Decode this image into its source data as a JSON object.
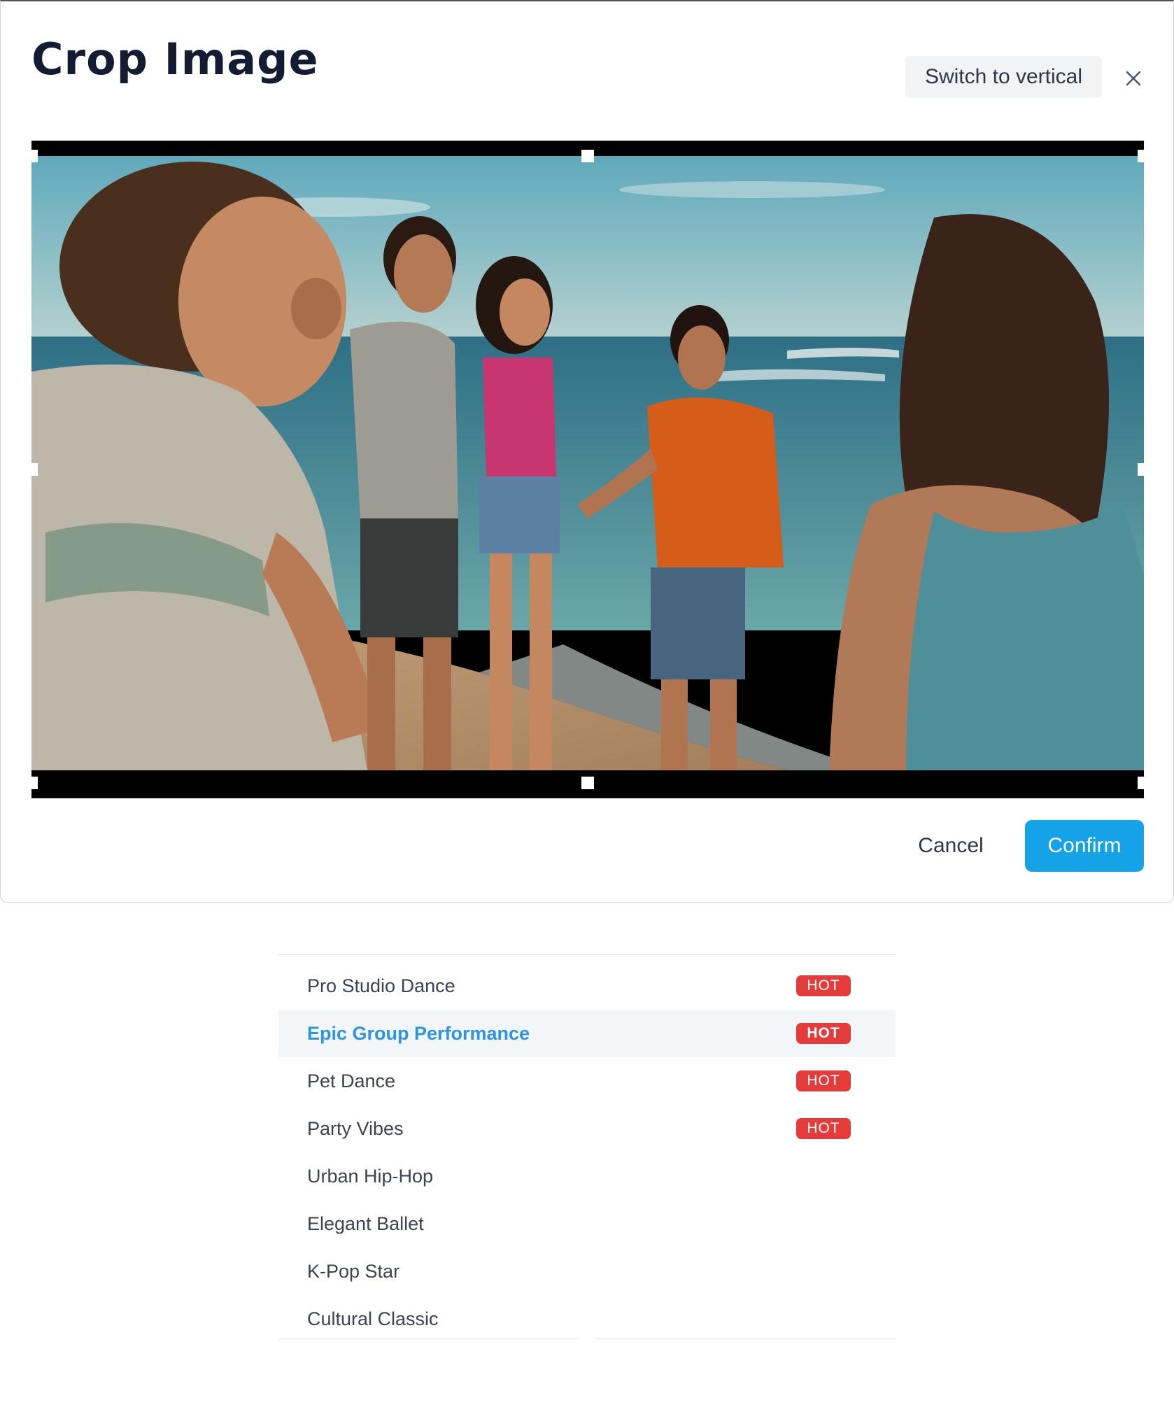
{
  "modal": {
    "title": "Crop Image",
    "switch_label": "Switch to vertical",
    "cancel_label": "Cancel",
    "confirm_label": "Confirm"
  },
  "colors": {
    "accent": "#15a3e7",
    "hot_badge": "#e43b3b",
    "active_item_text": "#2f95e0"
  },
  "icons": {
    "close": "close-icon"
  },
  "dropdown": {
    "badge_label": "HOT",
    "active_index": 1,
    "items": [
      {
        "label": "Pro Studio Dance",
        "hot": true
      },
      {
        "label": "Epic Group Performance",
        "hot": true
      },
      {
        "label": "Pet Dance",
        "hot": true
      },
      {
        "label": "Party Vibes",
        "hot": true
      },
      {
        "label": "Urban Hip-Hop",
        "hot": false
      },
      {
        "label": "Elegant Ballet",
        "hot": false
      },
      {
        "label": "K-Pop Star",
        "hot": false
      },
      {
        "label": "Cultural Classic",
        "hot": false
      }
    ]
  }
}
